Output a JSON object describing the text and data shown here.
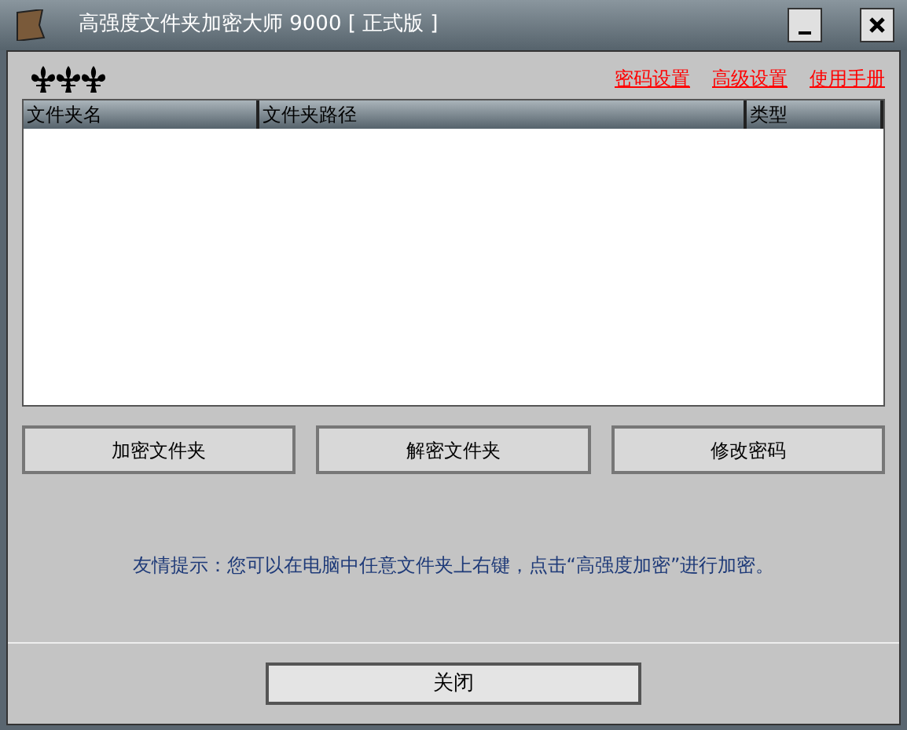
{
  "window": {
    "title": "高强度文件夹加密大师 9000 [ 正式版 ]"
  },
  "links": [
    "密码设置",
    "高级设置",
    "使用手册"
  ],
  "table": {
    "columns": [
      "文件夹名",
      "文件夹路径",
      "类型"
    ]
  },
  "buttons": [
    "加密文件夹",
    "解密文件夹",
    "修改密码"
  ],
  "hint": "友情提示：您可以在电脑中任意文件夹上右键，点击“高强度加密”进行加密。",
  "close_button": "关闭"
}
